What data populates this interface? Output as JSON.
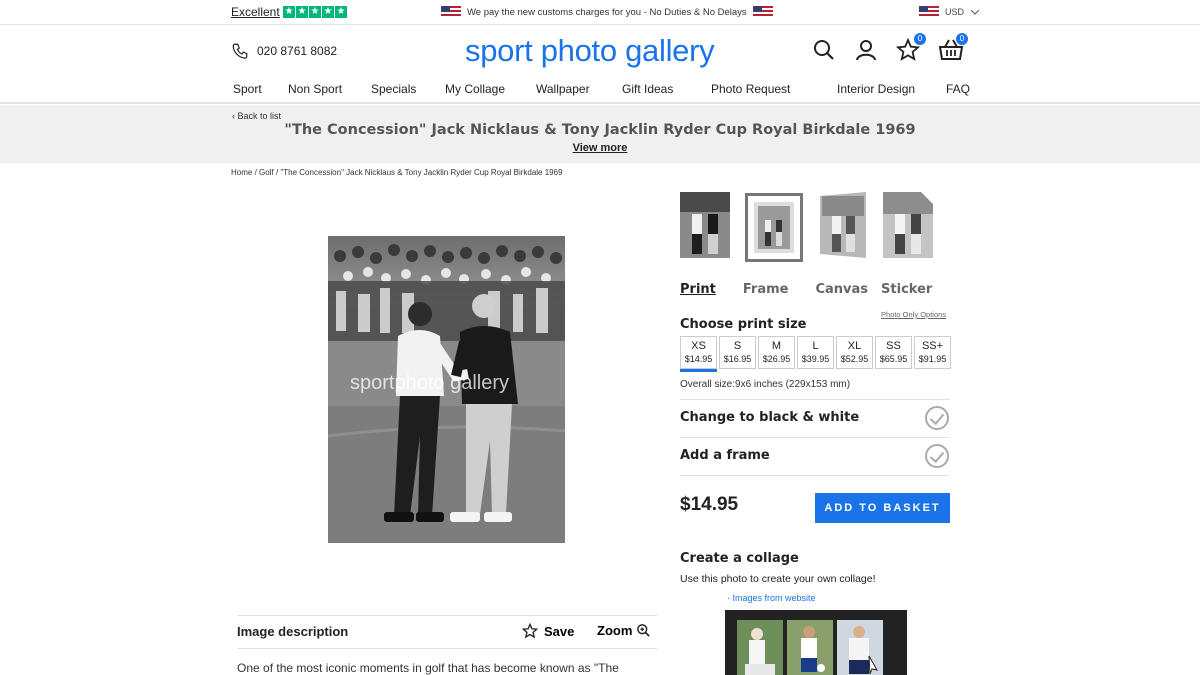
{
  "topbar": {
    "trust_label": "Excellent",
    "promo_text": "We pay the new customs charges for you - No Duties & No Delays",
    "currency": "USD"
  },
  "header": {
    "phone": "020 8761 8082",
    "logo": "sport photo gallery",
    "account_count": "0",
    "basket_count": "0"
  },
  "nav": {
    "items": [
      "Sport",
      "Non Sport",
      "Specials",
      "My Collage",
      "Wallpaper",
      "Gift Ideas",
      "Photo Request",
      "Interior Design",
      "FAQ"
    ]
  },
  "title_band": {
    "back_label": "Back to list",
    "title": "\"The Concession\" Jack Nicklaus & Tony Jacklin Ryder Cup Royal Birkdale 1969",
    "view_more": "View more"
  },
  "breadcrumb": {
    "home": "Home",
    "category": "Golf",
    "current": "\"The Concession\" Jack Nicklaus & Tony Jacklin Ryder Cup Royal Birkdale 1969",
    "separator": "/"
  },
  "photo": {
    "watermark": "sportphoto gallery"
  },
  "description": {
    "title": "Image description",
    "save_label": "Save",
    "zoom_label": "Zoom",
    "text": "One of the most iconic moments in golf that has become known as \"The"
  },
  "product": {
    "tabs": [
      "Print",
      "Frame",
      "Canvas",
      "Sticker"
    ],
    "active_tab": "Print",
    "photo_only": "Photo Only Options",
    "choose_size": "Choose print size",
    "sizes": [
      {
        "name": "XS",
        "price": "$14.95"
      },
      {
        "name": "S",
        "price": "$16.95"
      },
      {
        "name": "M",
        "price": "$26.95"
      },
      {
        "name": "L",
        "price": "$39.95"
      },
      {
        "name": "XL",
        "price": "$52.95"
      },
      {
        "name": "SS",
        "price": "$65.95"
      },
      {
        "name": "SS+",
        "price": "$91.95"
      }
    ],
    "selected_size": "XS",
    "overall_size": "Overall size:9x6 inches (229x153 mm)",
    "option_bw": "Change to black & white",
    "option_frame": "Add a frame",
    "price": "$14.95",
    "add_to_basket": "ADD TO BASKET"
  },
  "collage": {
    "title": "Create a collage",
    "text": "Use this photo to create your own collage!",
    "caption": "· Images from website"
  },
  "colors": {
    "brand_blue": "#1a73e8",
    "trustpilot_green": "#00b67a"
  }
}
